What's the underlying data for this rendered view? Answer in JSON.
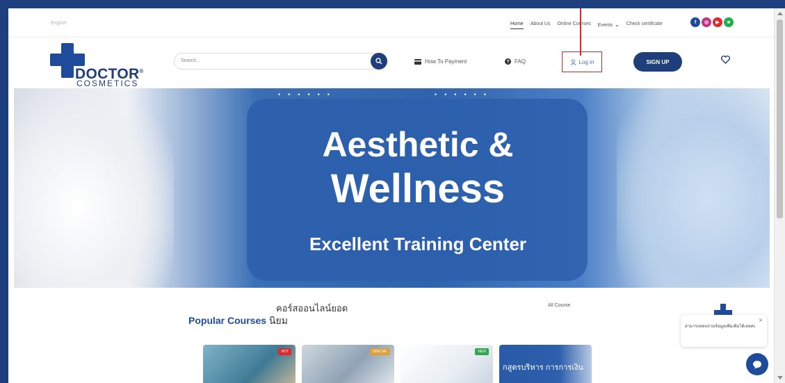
{
  "topbar": {
    "language": "English",
    "nav": [
      "Home",
      "About Us",
      "Online Courses",
      "Events",
      "Check certificate"
    ],
    "social_icons": [
      "facebook-icon",
      "instagram-icon",
      "youtube-icon",
      "line-icon"
    ],
    "social_colors": [
      "#1f4c9a",
      "#c13584",
      "#e02a2a",
      "#1fb04b"
    ]
  },
  "brand": {
    "name": "DOCTOR",
    "registered": "®",
    "sub": "COSMETICS",
    "color": "#1f3f7a"
  },
  "search": {
    "placeholder": "Search..."
  },
  "header": {
    "payment": "How To Payment",
    "faq": "FAQ",
    "login": "Log in",
    "signup": "SIGN UP"
  },
  "hero": {
    "title_line1": "Aesthetic &",
    "title_line2": "Wellness",
    "subtitle": "Excellent Training Center"
  },
  "popular": {
    "thai_line1": "คอร์สออนไลน์ยอด",
    "title_en": "Popular Courses",
    "title_th": "นิยม",
    "all_course": "All Course",
    "cards": [
      {
        "badge": "HOT",
        "badge_color": "#e02a2a",
        "text": ""
      },
      {
        "badge": "SPECIAL",
        "badge_color": "#e0a03a",
        "text": ""
      },
      {
        "badge": "NEW",
        "badge_color": "#2fa84f",
        "text": ""
      },
      {
        "badge": "",
        "badge_color": "",
        "text": "กสูตรบริหาร การการเงิน"
      }
    ]
  },
  "chat": {
    "message": "สามารถสอบถามข้อมูลเพิ่มเติมได้เลยค่ะ",
    "close": "×"
  },
  "accent": "#1f3f7a",
  "annotation_color": "#c62b36"
}
